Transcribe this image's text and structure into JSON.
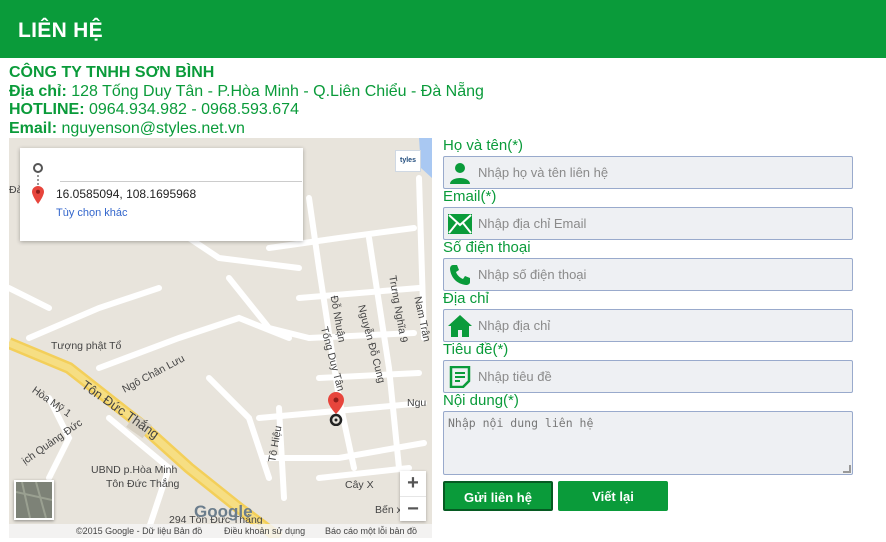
{
  "header": {
    "title": "LIÊN HỆ"
  },
  "company": {
    "name": "CÔNG TY TNHH SƠN BÌNH",
    "address_label": "Địa chỉ:",
    "address": "128 Tống Duy Tân - P.Hòa Minh - Q.Liên Chiểu - Đà Nẵng",
    "hotline_label": "HOTLINE:",
    "hotline": "0964.934.982 - 0968.593.674",
    "email_label": "Email:",
    "email": "nguyenson@styles.net.vn"
  },
  "map": {
    "coords": "16.0585094, 108.1695968",
    "more_options": "Tùy chọn khác",
    "logo_text": "tyles",
    "zoom_in": "+",
    "zoom_out": "−",
    "google": "Google",
    "copyright": "©2015 Google - Dữ liệu Bản đồ",
    "terms": "Điều khoản sử dụng",
    "report": "Báo cáo một lỗi bản đồ",
    "labels": {
      "dao": "Đào",
      "truong_phat_to": "Tượng phật Tổ",
      "ngo_chan_luu": "Ngô Chân Lưu",
      "ton_duc_thang": "Tôn Đức Thắng",
      "hoa_my_1": "Hòa Mỹ 1",
      "do_nhuan": "Đỗ Nhuận",
      "tong_duy_tan": "Tống Duy Tân",
      "nguyen_do_cung": "Nguyễn Đỗ Cung",
      "trung_nghia_9": "Trưng Nghĩa 9",
      "nam_tran": "Nam Trân",
      "to_hieu": "Tô Hiệu",
      "ngu": "Ngu",
      "quang_duc": "ịch Quảng Đức",
      "ubnd": "UBND p.Hòa Minh",
      "ubnd2": "Tôn Đức Thắng",
      "cay_x": "Cây X",
      "ben_x": "Bến x",
      "ton_duc_thang_294": "294 Tôn Đức Thắng"
    }
  },
  "form": {
    "name_label": "Họ và tên(*)",
    "name_placeholder": "Nhập họ và tên liên hệ",
    "email_label": "Email(*)",
    "email_placeholder": "Nhập địa chỉ Email",
    "phone_label": "Số điện thoại",
    "phone_placeholder": "Nhập số điện thoại",
    "address_label": "Địa chỉ",
    "address_placeholder": "Nhập địa chỉ",
    "subject_label": "Tiêu đề(*)",
    "subject_placeholder": "Nhập tiêu đề",
    "content_label": "Nội dung(*)",
    "content_placeholder": "Nhập nội dung liên hệ",
    "send_label": "Gửi liên hệ",
    "reset_label": "Viết lại"
  },
  "colors": {
    "brand": "#0a9b3a",
    "field_bg": "#eef0f3"
  }
}
